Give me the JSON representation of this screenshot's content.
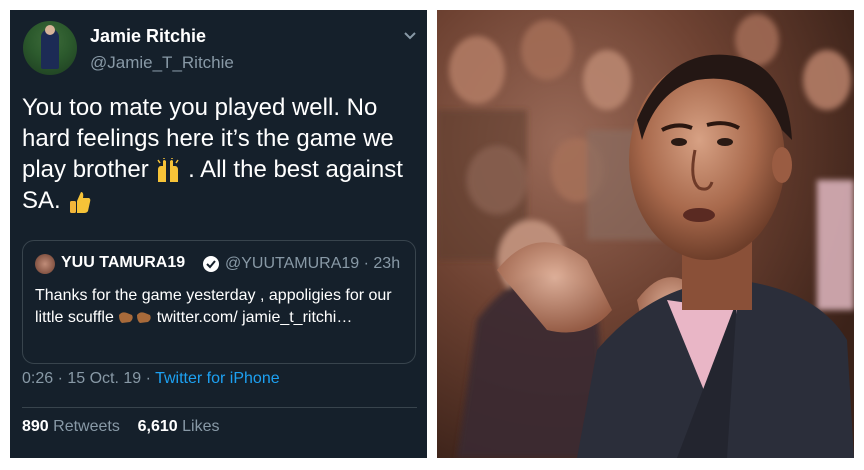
{
  "tweet": {
    "author_name": "Jamie Ritchie",
    "author_handle": "@Jamie_T_Ritchie",
    "text_part1": "You too mate you played well. No hard feelings here it’s the game we play brother ",
    "text_part2": ". All the best against SA. ",
    "quoted": {
      "name": "YUU TAMURA19",
      "handle": "@YUUTAMURA19 · 23h",
      "text_part1": "Thanks for the game yesterday , appoligies for our little scuffle ",
      "text_part2": " twitter.com/ jamie_t_ritchi…"
    },
    "time": "0:26 · 15 Oct. 19 · ",
    "client": "Twitter for iPhone",
    "retweets_count": "890",
    "retweets_label": " Retweets",
    "likes_count": "6,610",
    "likes_label": " Likes"
  },
  "icons": {
    "raised_hands": "raised-hands-emoji",
    "thumbs_up": "thumbs-up-emoji",
    "fist_bump": "fist-bump-emoji",
    "verified": "verified-badge-icon",
    "chevron": "chevron-down-icon"
  },
  "colors": {
    "background": "#15202b",
    "secondary_text": "#8899a6",
    "link": "#1da1f2",
    "border": "#38444d"
  }
}
